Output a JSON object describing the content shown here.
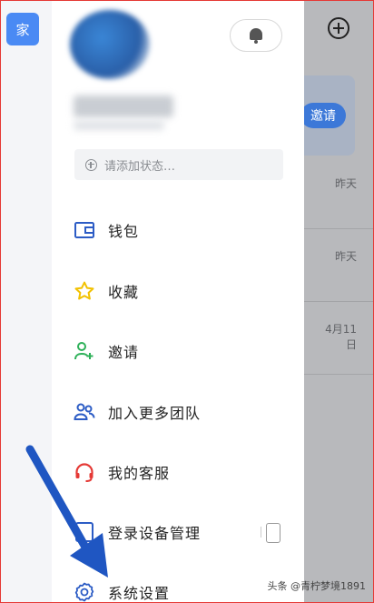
{
  "rail": {
    "team_badge": "家"
  },
  "background": {
    "invite_button": "邀请",
    "times": [
      "昨天",
      "昨天",
      "4月11日"
    ]
  },
  "drawer": {
    "status_placeholder": "请添加状态…",
    "menu": [
      {
        "label": "钱包",
        "icon": "wallet-icon"
      },
      {
        "label": "收藏",
        "icon": "star-icon"
      },
      {
        "label": "邀请",
        "icon": "add-user-icon"
      },
      {
        "label": "加入更多团队",
        "icon": "team-icon"
      },
      {
        "label": "我的客服",
        "icon": "headset-icon"
      },
      {
        "label": "登录设备管理",
        "icon": "device-icon"
      },
      {
        "label": "系统设置",
        "icon": "gear-icon"
      }
    ]
  },
  "watermark": "头条 @青柠梦境1891",
  "colors": {
    "accent": "#2c5cc5",
    "star": "#f2c100",
    "green": "#2fb15a",
    "red": "#e53935",
    "arrow": "#1f56c2"
  }
}
